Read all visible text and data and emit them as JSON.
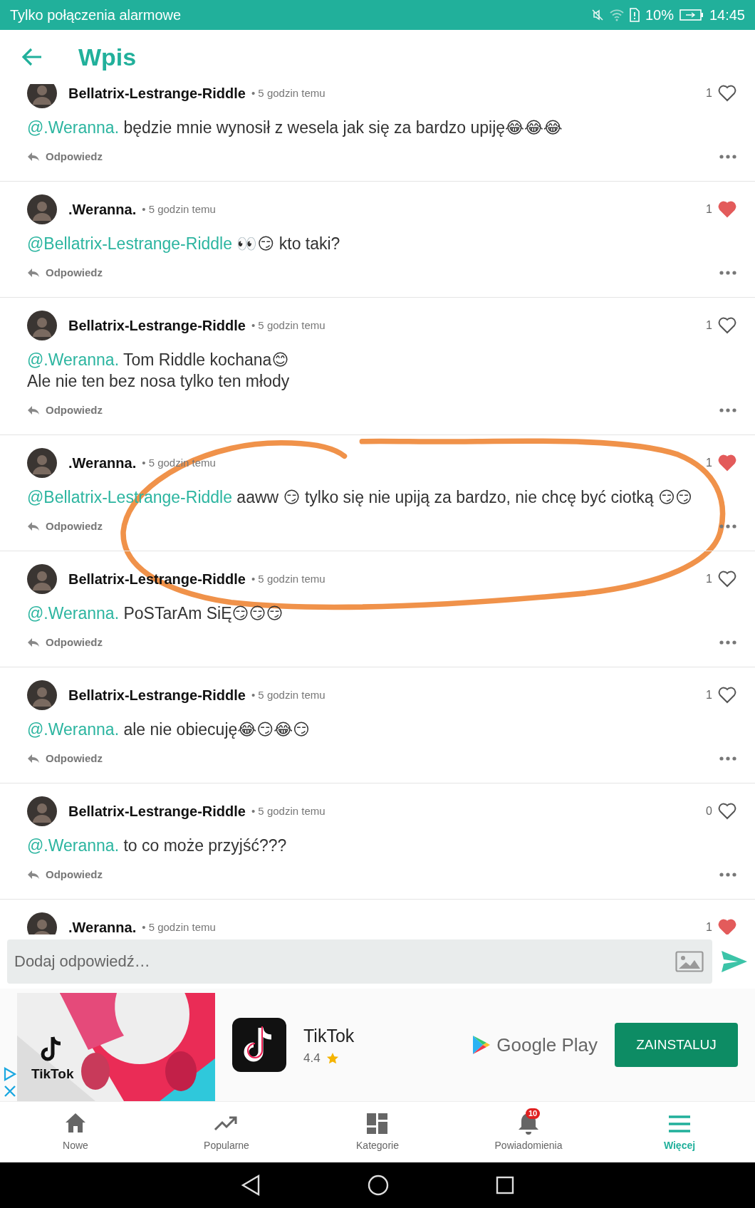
{
  "status_bar": {
    "carrier": "Tylko połączenia alarmowe",
    "battery": "10%",
    "time": "14:45"
  },
  "header": {
    "title": "Wpis"
  },
  "comments": [
    {
      "author": "Bellatrix-Lestrange-Riddle",
      "time": "• 5 godzin temu",
      "mention": "@.Weranna.",
      "body": " będzie mnie wynosił z wesela jak się za bardzo upiję😂😂😂",
      "likes": "1",
      "liked": false,
      "reply": "Odpowiedz"
    },
    {
      "author": ".Weranna.",
      "time": "• 5 godzin temu",
      "mention": "@Bellatrix-Lestrange-Riddle",
      "body": " 👀😏 kto taki?",
      "likes": "1",
      "liked": true,
      "reply": "Odpowiedz"
    },
    {
      "author": "Bellatrix-Lestrange-Riddle",
      "time": "• 5 godzin temu",
      "mention": "@.Weranna.",
      "body": " Tom Riddle kochana😊\nAle nie ten bez nosa tylko ten młody",
      "likes": "1",
      "liked": false,
      "reply": "Odpowiedz"
    },
    {
      "author": ".Weranna.",
      "time": "• 5 godzin temu",
      "mention": "@Bellatrix-Lestrange-Riddle",
      "body": " aaww 😏 tylko się nie upiją za bardzo, nie chcę być ciotką 😏😏",
      "likes": "1",
      "liked": true,
      "reply": "Odpowiedz"
    },
    {
      "author": "Bellatrix-Lestrange-Riddle",
      "time": "• 5 godzin temu",
      "mention": "@.Weranna.",
      "body": " PoSTarAm SiĘ😏😏😏",
      "likes": "1",
      "liked": false,
      "reply": "Odpowiedz"
    },
    {
      "author": "Bellatrix-Lestrange-Riddle",
      "time": "• 5 godzin temu",
      "mention": "@.Weranna.",
      "body": " ale nie obiecuję😂😏😂😏",
      "likes": "1",
      "liked": false,
      "reply": "Odpowiedz"
    },
    {
      "author": "Bellatrix-Lestrange-Riddle",
      "time": "• 5 godzin temu",
      "mention": "@.Weranna.",
      "body": " to co może przyjść???",
      "likes": "0",
      "liked": false,
      "reply": "Odpowiedz"
    },
    {
      "author": ".Weranna.",
      "time": "• 5 godzin temu",
      "likes": "1",
      "liked": true
    }
  ],
  "reply_input": {
    "placeholder": "Dodaj odpowiedź…"
  },
  "ad": {
    "banner_label": "TikTok",
    "app_name": "TikTok",
    "rating": "4.4",
    "stars": 1,
    "store": "Google Play",
    "install": "ZAINSTALUJ"
  },
  "bottom_nav": [
    {
      "label": "Nowe",
      "selected": false
    },
    {
      "label": "Popularne",
      "selected": false
    },
    {
      "label": "Kategorie",
      "selected": false
    },
    {
      "label": "Powiadomienia",
      "selected": false,
      "badge": "10"
    },
    {
      "label": "Więcej",
      "selected": true
    }
  ]
}
